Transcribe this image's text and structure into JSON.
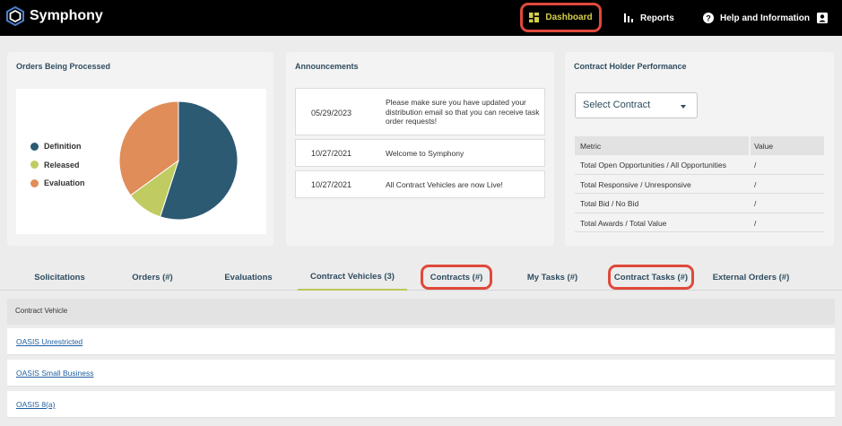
{
  "app": {
    "name": "Symphony"
  },
  "nav": {
    "dashboard": "Dashboard",
    "reports": "Reports",
    "help": "Help and Information"
  },
  "orders_panel": {
    "title": "Orders Being Processed",
    "legend": [
      {
        "label": "Definition",
        "color": "#2c5a72"
      },
      {
        "label": "Released",
        "color": "#c0cc62"
      },
      {
        "label": "Evaluation",
        "color": "#e08d59"
      }
    ]
  },
  "chart_data": {
    "type": "pie",
    "categories": [
      "Definition",
      "Released",
      "Evaluation"
    ],
    "values": [
      55,
      10,
      35
    ],
    "colors": [
      "#2c5a72",
      "#c0cc62",
      "#e08d59"
    ],
    "legend_position": "left"
  },
  "announcements": {
    "title": "Announcements",
    "items": [
      {
        "date": "05/29/2023",
        "text": "Please make sure you have updated your distribution email so that you can receive task order requests!"
      },
      {
        "date": "10/27/2021",
        "text": "Welcome to Symphony"
      },
      {
        "date": "10/27/2021",
        "text": "All Contract Vehicles are now Live!"
      }
    ]
  },
  "performance": {
    "title": "Contract Holder Performance",
    "select_label": "Select Contract",
    "columns": [
      "Metric",
      "Value"
    ],
    "rows": [
      {
        "metric": "Total Open Opportunities / All Opportunities",
        "value": "/"
      },
      {
        "metric": "Total Responsive / Unresponsive",
        "value": "/"
      },
      {
        "metric": "Total Bid / No Bid",
        "value": "/"
      },
      {
        "metric": "Total Awards / Total Value",
        "value": "/"
      }
    ]
  },
  "tabs": [
    "Solicitations",
    "Orders (#)",
    "Evaluations",
    "Contract Vehicles (3)",
    "Contracts (#)",
    "My Tasks (#)",
    "Contract Tasks (#)",
    "External Orders (#)"
  ],
  "vehicles": {
    "header": "Contract Vehicle",
    "rows": [
      "OASIS Unrestricted",
      "OASIS Small Business",
      "OASIS 8(a)"
    ]
  },
  "colors": {
    "accent": "#d6cf4a",
    "highlight": "#e0493b",
    "title_text": "#2e4c5f",
    "link": "#1f5f9f"
  }
}
